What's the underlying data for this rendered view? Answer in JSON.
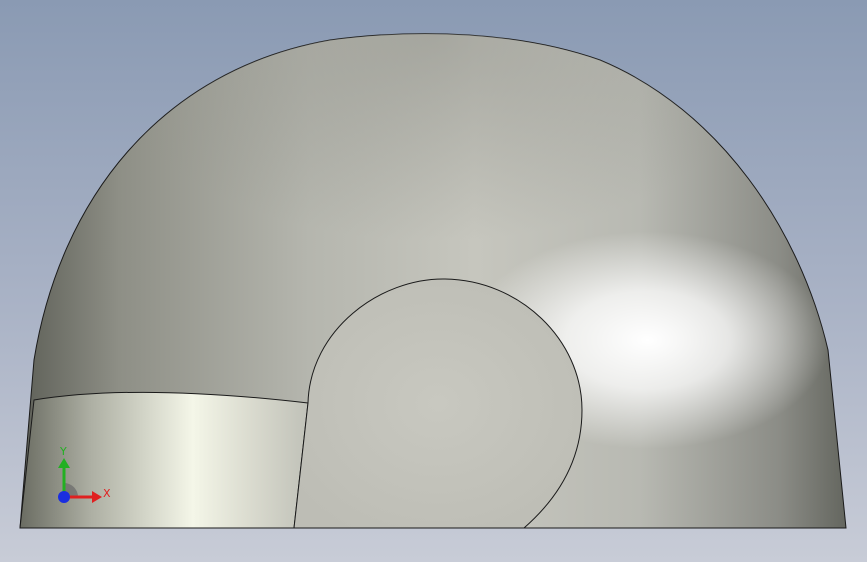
{
  "viewport": {
    "background_top": "#8a9ab3",
    "background_bottom": "#c8ccd7"
  },
  "model": {
    "shape": "half-dome elbow with circular port",
    "base_color": "#c4c4bc",
    "highlight_color": "#ffffff",
    "shadow_color": "#5e6058",
    "edge_color": "#1a1a1a"
  },
  "triad": {
    "x_label": "X",
    "y_label": "Y",
    "x_color": "#e02020",
    "y_color": "#22b022",
    "z_color": "#1a2ee0"
  }
}
